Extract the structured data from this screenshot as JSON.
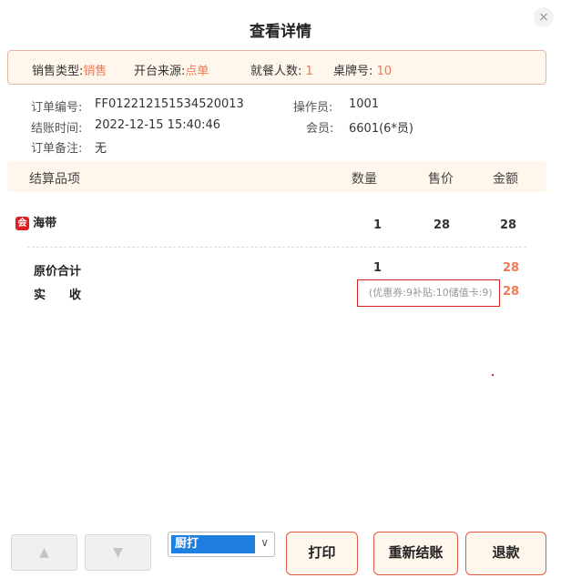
{
  "dialog": {
    "title": "查看详情",
    "close_icon": "×"
  },
  "infobar": {
    "sale_type_label": "销售类型:",
    "sale_type_value": "销售",
    "source_label": "开台来源:",
    "source_value": "点单",
    "guests_label": "就餐人数:",
    "guests_value": "1",
    "table_label": "桌牌号:",
    "table_value": "10"
  },
  "order": {
    "number_label": "订单编号:",
    "number_value": "FF012212151534520013",
    "time_label": "结账时间:",
    "time_value": "2022-12-15 15:40:46",
    "note_label": "订单备注:",
    "note_value": "无",
    "operator_label": "操作员:",
    "operator_value": "1001",
    "member_label": "会员:",
    "member_value": "6601(6*员)"
  },
  "table": {
    "headers": [
      "结算品项",
      "数量",
      "售价",
      "金额"
    ],
    "rows": [
      {
        "badge": "会",
        "name": "海带",
        "qty": "1",
        "price": "28",
        "amount": "28"
      }
    ]
  },
  "summary": {
    "original_label": "原价合计",
    "original_qty": "1",
    "original_amount": "28",
    "actual_label": "实　　收",
    "actual_discount": "(优惠券:9补贴:10储值卡:9)",
    "actual_amount": "28"
  },
  "footer": {
    "up_icon": "▲",
    "down_icon": "▼",
    "printer_selected": "厨打",
    "chevron": "∨",
    "print_label": "打印",
    "resettle_label": "重新结账",
    "refund_label": "退款"
  }
}
